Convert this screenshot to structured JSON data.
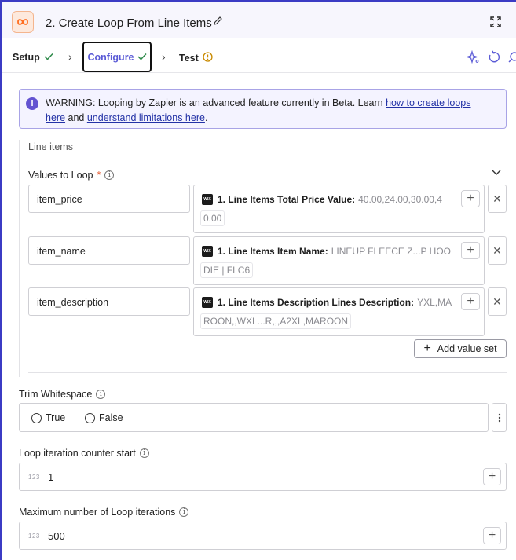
{
  "header": {
    "step_title": "2. Create Loop From Line Items",
    "app_icon": "loop-infinity-icon",
    "accent": "#3b3bc4",
    "brand_color": "#ff6d1f"
  },
  "tabs": {
    "setup": "Setup",
    "configure": "Configure",
    "test": "Test"
  },
  "warning": {
    "prefix": "WARNING: Looping by Zapier is an advanced feature currently in Beta. Learn ",
    "link1a": "how to create loops",
    "link1b": "here",
    "middle": " and ",
    "link2": "understand limitations here",
    "suffix": "."
  },
  "line_items": {
    "group_label": "Line items",
    "values_label": "Values to Loop",
    "required_mark": "*",
    "rows": [
      {
        "key": "item_price",
        "source_label": "1. Line Items Total Price Value:",
        "source_value": "40.00,24.00,30.00,4",
        "overflow": "0.00"
      },
      {
        "key": "item_name",
        "source_label": "1. Line Items Item Name:",
        "source_value": "LINEUP FLEECE Z...P HOO",
        "overflow": "DIE | FLC6"
      },
      {
        "key": "item_description",
        "source_label": "1. Line Items Description Lines Description:",
        "source_value": "YXL,MA",
        "overflow": "ROON,,WXL...R,,,A2XL,MAROON"
      }
    ],
    "add_value_set": "Add value set"
  },
  "trim_whitespace": {
    "label": "Trim Whitespace",
    "options": [
      "True",
      "False"
    ]
  },
  "counter_start": {
    "label": "Loop iteration counter start",
    "type_icon": "123",
    "value": "1"
  },
  "max_iterations": {
    "label": "Maximum number of Loop iterations",
    "type_icon": "123",
    "value": "500"
  }
}
